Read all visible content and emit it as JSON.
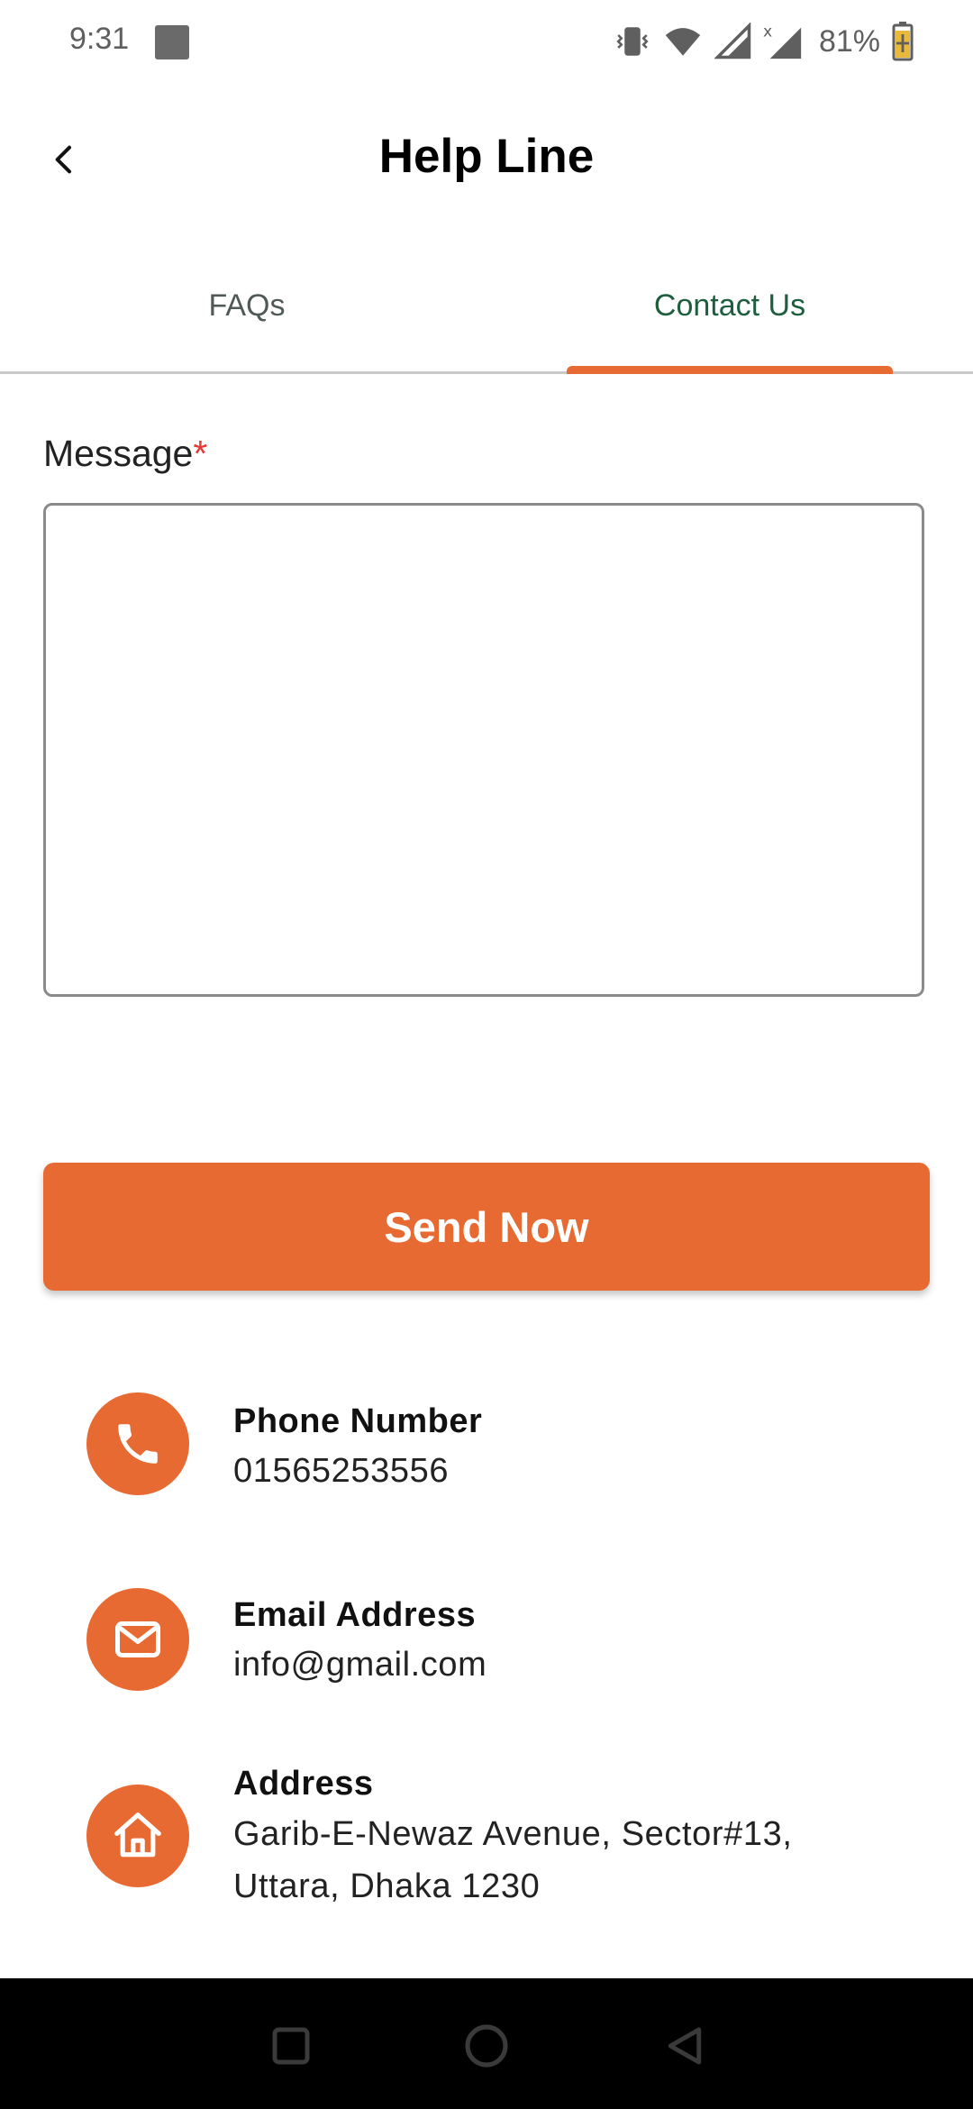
{
  "status_bar": {
    "time": "9:31",
    "battery_percent": "81%",
    "icons": [
      "vibrate-icon",
      "wifi-icon",
      "signal-icon",
      "signal-x-icon",
      "battery-charging-icon"
    ]
  },
  "header": {
    "title": "Help Line",
    "back_icon": "chevron-left-icon"
  },
  "tabs": [
    {
      "label": "FAQs",
      "selected": false
    },
    {
      "label": "Contact Us",
      "selected": true
    }
  ],
  "form": {
    "message_label": "Message",
    "required_mark": "*",
    "message_value": "",
    "send_label": "Send Now"
  },
  "contacts": [
    {
      "icon": "phone-icon",
      "title": "Phone Number",
      "value": "01565253556"
    },
    {
      "icon": "mail-icon",
      "title": "Email Address",
      "value": "info@gmail.com"
    },
    {
      "icon": "home-icon",
      "title": "Address",
      "value_line1": "Garib-E-Newaz Avenue, Sector#13,",
      "value_line2": "Uttara, Dhaka 1230"
    }
  ],
  "colors": {
    "accent": "#e86a33",
    "tab_selected": "#1e5e3e",
    "required": "#e53935"
  },
  "nav": {
    "icons": [
      "recents-icon",
      "home-circle-icon",
      "back-triangle-icon"
    ]
  }
}
